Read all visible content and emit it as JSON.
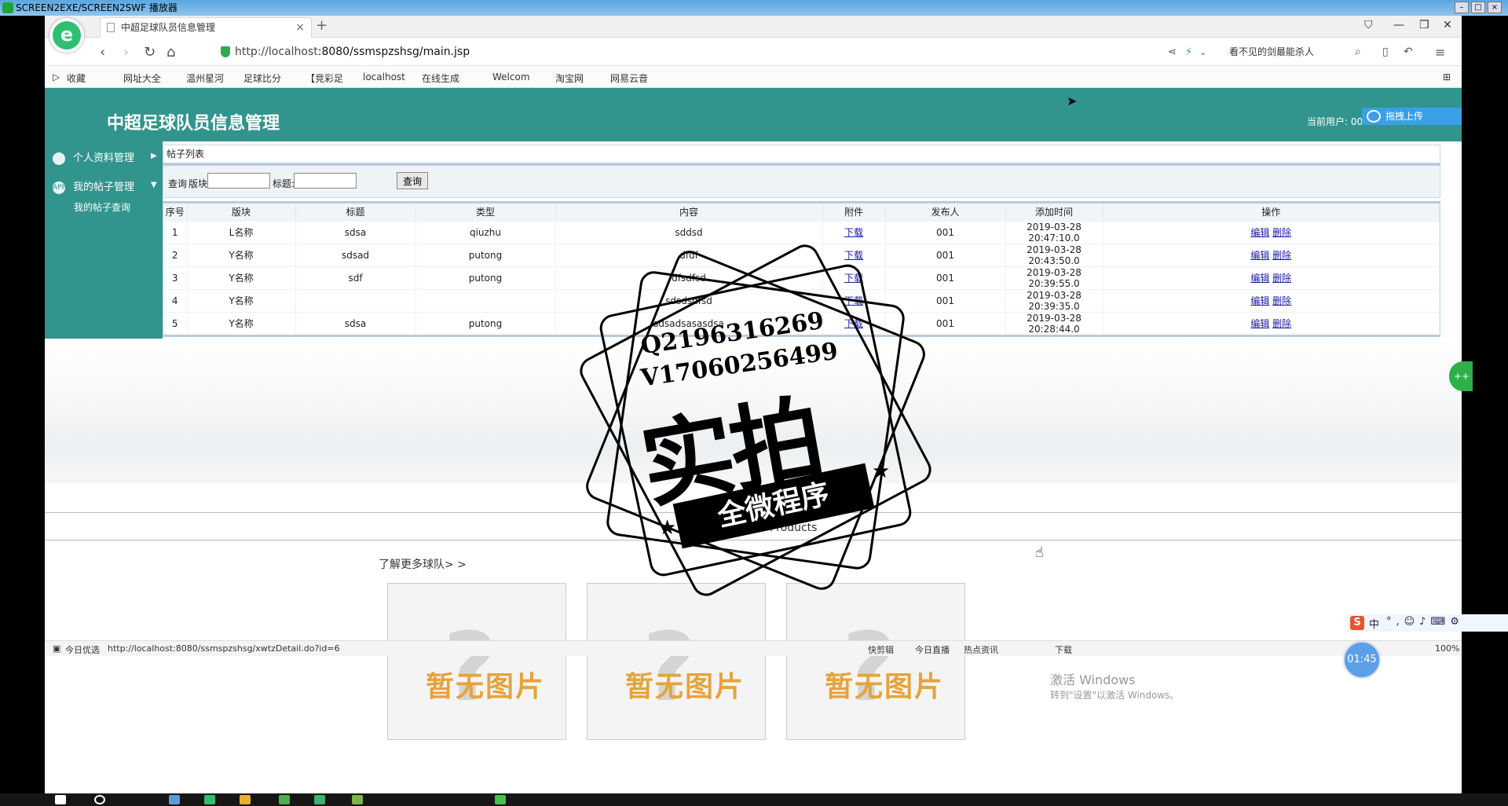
{
  "player": {
    "title": "SCREEN2EXE/SCREEN2SWF 播放器"
  },
  "browser": {
    "tab_title": "中超足球队员信息管理",
    "url_host": "http://localhost",
    "url_rest": ":8080/ssmspzshsg/main.jsp",
    "search_text": "看不见的剑最能杀人",
    "bookmarks": [
      "收藏",
      "网址大全",
      "温州星河",
      "足球比分",
      "【竞彩足",
      "localhost",
      "在线生成",
      "Welcom",
      "淘宝网",
      "网易云音"
    ]
  },
  "header": {
    "title": "中超足球队员信息管理",
    "user_label": "当前用户: 001",
    "upload_label": "拖拽上传"
  },
  "sidebar": {
    "items": [
      {
        "label": "个人资料管理",
        "icon_text": ""
      },
      {
        "label": "我的帖子管理",
        "icon_text": "APP"
      }
    ],
    "sub_items": [
      "我的帖子查询"
    ]
  },
  "panel": {
    "title": "帖子列表"
  },
  "search": {
    "prefix": "查询",
    "section_label": "版块:",
    "title_label": "标题:",
    "button_label": "查询"
  },
  "table": {
    "columns": [
      "序号",
      "版块",
      "标题",
      "类型",
      "内容",
      "附件",
      "发布人",
      "添加时间",
      "操作"
    ],
    "rows": [
      {
        "no": "1",
        "section": "L名称",
        "title": "sdsa",
        "type": "qiuzhu",
        "content": "sddsd",
        "attach": "下载",
        "poster": "001",
        "time": "2019-03-28 20:47:10.0",
        "edit": "编辑",
        "del": "删除"
      },
      {
        "no": "2",
        "section": "Y名称",
        "title": "sdsad",
        "type": "putong",
        "content": "dfdf",
        "attach": "下载",
        "poster": "001",
        "time": "2019-03-28 20:43:50.0",
        "edit": "编辑",
        "del": "删除"
      },
      {
        "no": "3",
        "section": "Y名称",
        "title": "sdf",
        "type": "putong",
        "content": "dfsdfsd",
        "attach": "下载",
        "poster": "001",
        "time": "2019-03-28 20:39:55.0",
        "edit": "编辑",
        "del": "删除"
      },
      {
        "no": "4",
        "section": "Y名称",
        "title": "",
        "type": "",
        "content": "sdsdsdfsd",
        "attach": "下载",
        "poster": "001",
        "time": "2019-03-28 20:39:35.0",
        "edit": "编辑",
        "del": "删除"
      },
      {
        "no": "5",
        "section": "Y名称",
        "title": "sdsa",
        "type": "putong",
        "content": "sdsadsasasdsa",
        "attach": "下载",
        "poster": "001",
        "time": "2019-03-28 20:28:44.0",
        "edit": "编辑",
        "del": "删除"
      }
    ]
  },
  "lower": {
    "new_products": "New Products",
    "more_teams": "了解更多球队> >",
    "no_image": "暂无图片",
    "activate_title": "激活 Windows",
    "activate_sub": "转到\"设置\"以激活 Windows。"
  },
  "status": {
    "left_label": "今日优选",
    "url": "http://localhost:8080/ssmspzshsg/xwtzDetail.do?id=6",
    "items": [
      "快剪辑",
      "今日直播",
      "热点资讯",
      "下载",
      "100%"
    ]
  },
  "watermark": {
    "line1": "Q2196316269",
    "line2": "V17060256499",
    "big": "实拍",
    "ribbon": "全微程序"
  },
  "overlay": {
    "clock": "01:45",
    "ime": "中"
  },
  "colors": {
    "header_bg": "#31958d",
    "link": "#1a1aa6"
  }
}
